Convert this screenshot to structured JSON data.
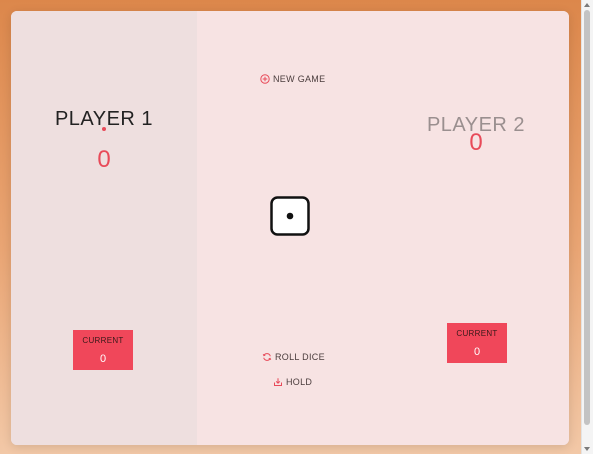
{
  "players": [
    {
      "name": "PLAYER 1",
      "score": "0",
      "current_label": "CURRENT",
      "current_score": "0",
      "active": true
    },
    {
      "name": "PLAYER 2",
      "score": "0",
      "current_label": "CURRENT",
      "current_score": "0",
      "active": false
    }
  ],
  "controls": {
    "new_game_label": "NEW GAME",
    "roll_dice_label": "ROLL DICE",
    "hold_label": "HOLD"
  },
  "dice": {
    "value": 1
  },
  "colors": {
    "accent": "#f0475a",
    "score": "#e84a59",
    "active_panel": "#eedfdf",
    "panel": "#f7e3e3"
  },
  "icons": {
    "new_game": "plus-circle-icon",
    "roll_dice": "refresh-icon",
    "hold": "download-icon"
  }
}
